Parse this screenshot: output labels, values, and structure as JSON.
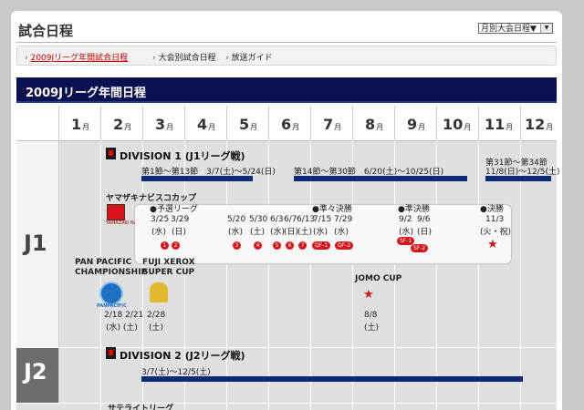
{
  "page": {
    "title": "試合日程",
    "select_value": "月別大会日程▼"
  },
  "tabs": [
    {
      "label": "2009Jリーグ年間試合日程"
    },
    {
      "label": "大会別試合日程"
    },
    {
      "label": "放送ガイド"
    }
  ],
  "section_header": "2009Jリーグ年間日程",
  "months": [
    {
      "num": "1",
      "suffix": "月"
    },
    {
      "num": "2",
      "suffix": "月"
    },
    {
      "num": "3",
      "suffix": "月"
    },
    {
      "num": "4",
      "suffix": "月"
    },
    {
      "num": "5",
      "suffix": "月"
    },
    {
      "num": "6",
      "suffix": "月"
    },
    {
      "num": "7",
      "suffix": "月"
    },
    {
      "num": "8",
      "suffix": "月"
    },
    {
      "num": "9",
      "suffix": "月"
    },
    {
      "num": "10",
      "suffix": "月"
    },
    {
      "num": "11",
      "suffix": "月"
    },
    {
      "num": "12",
      "suffix": "月"
    }
  ],
  "rows": {
    "j1": "J1",
    "j2": "J2"
  },
  "division1": {
    "title": "DIVISION 1 (J1リーグ戦)",
    "first_stage": "第1節〜第13節　3/7(土)〜5/24(日)",
    "mid_stage": "第14節〜第30節　6/20(土)〜10/25(日)",
    "final_stage": "第31節〜第34節",
    "final_dates": "11/8(日)〜12/5(土)"
  },
  "nabisco": {
    "title": "ヤマザキナビスコカップ",
    "logo_text": "YAMAZAKI NABISCO CUP",
    "group": "●予選リーグ",
    "qf": "●準々決勝",
    "sf": "●準決勝",
    "final": "●決勝",
    "dates": [
      {
        "d": "3/25",
        "w": "(水)"
      },
      {
        "d": "3/29",
        "w": "(日)"
      },
      {
        "d": "5/20",
        "w": "(水)"
      },
      {
        "d": "5/30",
        "w": "(土)"
      },
      {
        "d": "6/3",
        "w": "(水)"
      },
      {
        "d": "6/7",
        "w": "(日)"
      },
      {
        "d": "6/13",
        "w": "(土)"
      },
      {
        "d": "7/15",
        "w": "(水)"
      },
      {
        "d": "7/29",
        "w": "(水)"
      },
      {
        "d": "9/2",
        "w": "(水)"
      },
      {
        "d": "9/6",
        "w": "(日)"
      },
      {
        "d": "11/3",
        "w": "(火・祝)"
      }
    ],
    "rounds": [
      "1",
      "2",
      "3",
      "4",
      "5",
      "6",
      "7"
    ],
    "qf_tags": [
      "QF-1",
      "QF-2"
    ],
    "sf_tags": [
      "SF-1",
      "SF-2"
    ]
  },
  "pan_pacific": {
    "title_l1": "PAN PACIFIC",
    "title_l2": "CHAMPIONSHIP",
    "logo_text": "PANPACIFIC",
    "dates": "2/18 2/21",
    "days": "(水) (土)"
  },
  "xerox": {
    "title_l1": "FUJI XEROX",
    "title_l2": "SUPER CUP",
    "date": "2/28",
    "day": "(土)"
  },
  "jomo": {
    "title": "JOMO CUP",
    "date": "8/8",
    "day": "(土)"
  },
  "division2": {
    "title": "DIVISION 2 (J2リーグ戦)",
    "dates": "3/7(土)〜12/5(土)"
  },
  "satellite": {
    "title": "サテライトリーグ"
  },
  "colors": {
    "navy": "#0a1050",
    "bar": "#0c2a78",
    "red": "#d8141a"
  }
}
